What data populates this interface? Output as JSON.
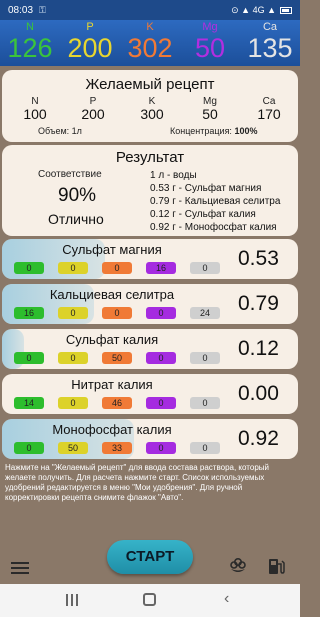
{
  "status": {
    "time": "08:03",
    "key_icon": "key-icon",
    "indicators": "⊙ ▲ 4G ▲",
    "colors": {
      "bar": "#1e4a8a"
    }
  },
  "header": {
    "elements": [
      {
        "symbol": "N",
        "value": "126",
        "color": "#3bc43b"
      },
      {
        "symbol": "P",
        "value": "200",
        "color": "#e8d630"
      },
      {
        "symbol": "K",
        "value": "302",
        "color": "#f07a36"
      },
      {
        "symbol": "Mg",
        "value": "50",
        "color": "#b22ee0"
      },
      {
        "symbol": "Ca",
        "value": "135",
        "color": "#e4e4e4"
      }
    ]
  },
  "recipe": {
    "title": "Желаемый рецепт",
    "columns": [
      {
        "label": "N",
        "value": "100"
      },
      {
        "label": "P",
        "value": "200"
      },
      {
        "label": "K",
        "value": "300"
      },
      {
        "label": "Mg",
        "value": "50"
      },
      {
        "label": "Ca",
        "value": "170"
      }
    ],
    "volume": "Объем: 1л",
    "concentration_label": "Концентрация:",
    "concentration_value": "100%"
  },
  "result": {
    "title": "Результат",
    "match_label": "Соответствие",
    "match_value": "90%",
    "match_text": "Отлично",
    "lines": [
      "1 л - воды",
      "0.53 г - Сульфат магния",
      "0.79 г - Кальциевая селитра",
      "0.12 г - Сульфат калия",
      "0.92 г - Монофосфат калия"
    ]
  },
  "pill_colors": [
    "#2dbd2d",
    "#dcd22a",
    "#f07a36",
    "#a52be0",
    "#cfcfcf"
  ],
  "fertilizers": [
    {
      "name": "Сульфат магния",
      "value": "0.53",
      "levels": [
        "0",
        "0",
        "0",
        "16",
        "0"
      ],
      "highlight_fraction": 0.47
    },
    {
      "name": "Кальциевая селитра",
      "value": "0.79",
      "levels": [
        "16",
        "0",
        "0",
        "0",
        "24"
      ],
      "highlight_fraction": 0.42
    },
    {
      "name": "Сульфат калия",
      "value": "0.12",
      "levels": [
        "0",
        "0",
        "50",
        "0",
        "0"
      ],
      "highlight_fraction": 0.1
    },
    {
      "name": "Нитрат калия",
      "value": "0.00",
      "levels": [
        "14",
        "0",
        "46",
        "0",
        "0"
      ],
      "highlight_fraction": 0.0
    },
    {
      "name": "Монофосфат калия",
      "value": "0.92",
      "levels": [
        "0",
        "50",
        "33",
        "0",
        "0"
      ],
      "highlight_fraction": 0.6
    }
  ],
  "hint": "Нажмите на \"Желаемый рецепт\" для ввода состава раствора, который желаете получить. Для расчета нажмите старт. Список используемых удобрений редактируется в меню \"Мои удобрения\". Для ручной корректировки рецепта снимите флажок \"Авто\".",
  "bottom": {
    "start_label": "СТАРТ",
    "menu_icon": "hamburger-menu-icon",
    "flower_icon": "flower-icon",
    "fuel_icon": "fuel-pump-icon"
  },
  "navbar": {
    "recent_icon": "recent-apps-icon",
    "home_icon": "home-icon",
    "back_icon": "back-icon"
  }
}
